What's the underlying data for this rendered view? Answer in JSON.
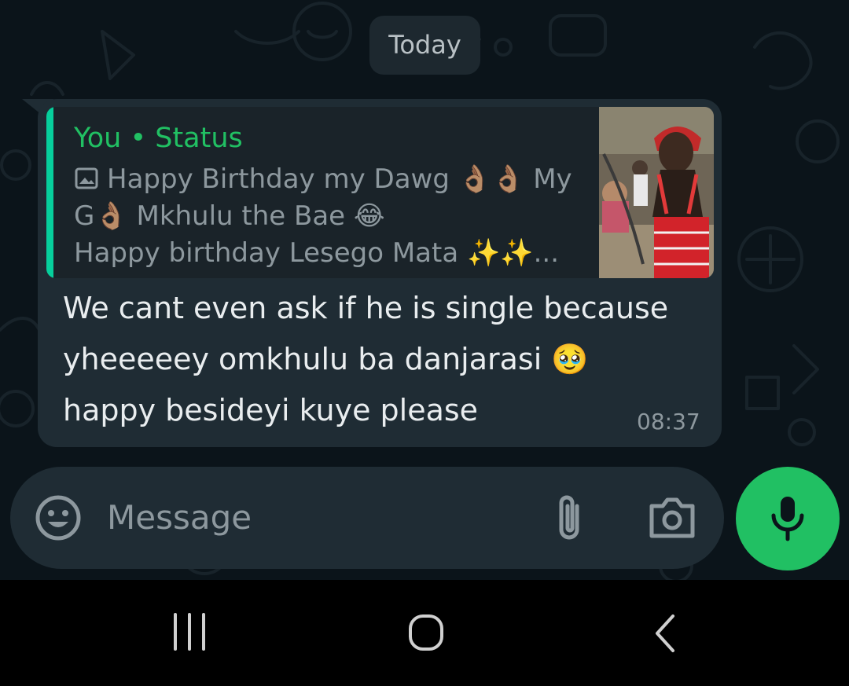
{
  "chat": {
    "date_chip": "Today"
  },
  "message": {
    "quote": {
      "sender": "You • Status",
      "lines": [
        "Happy Birthday my Dawg 👌🏽👌🏽 My",
        "G👌🏽 Mkhulu the Bae 😂",
        "Happy birthday Lesego Mata ✨✨..."
      ],
      "thumbnail_icon": "status-photo-thumbnail"
    },
    "body_lines": [
      "We cant even ask if he is single because",
      "yheeeeey omkhulu ba danjarasi 🥹",
      "happy besideyi kuye please"
    ],
    "time": "08:37"
  },
  "composer": {
    "placeholder": "Message",
    "emoji_icon": "emoji-icon",
    "attach_icon": "paperclip-icon",
    "camera_icon": "camera-icon",
    "mic_icon": "mic-icon"
  },
  "navbar": {
    "recents_icon": "recents-icon",
    "home_icon": "home-icon",
    "back_icon": "back-icon"
  },
  "colors": {
    "background": "#0b141a",
    "bubble": "#1f2c34",
    "quote_background": "#1a2329",
    "quote_bar": "#06cf9c",
    "accent_green": "#21c063",
    "text_primary": "#e9edef",
    "text_secondary": "#8d989e"
  }
}
